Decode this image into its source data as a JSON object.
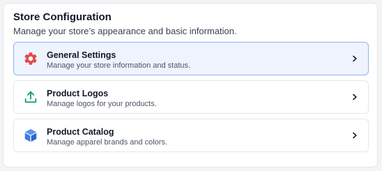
{
  "header": {
    "title": "Store Configuration",
    "subtitle": "Manage your store’s appearance and basic information."
  },
  "items": [
    {
      "label": "General Settings",
      "description": "Manage your store information and status.",
      "icon": "gear-icon",
      "icon_color": "#e5484d",
      "selected": true
    },
    {
      "label": "Product Logos",
      "description": "Manage logos for your products.",
      "icon": "upload-icon",
      "icon_color": "#1a9e6a",
      "selected": false
    },
    {
      "label": "Product Catalog",
      "description": "Manage apparel brands and colors.",
      "icon": "cube-icon",
      "icon_color": "#3b7be8",
      "selected": false
    }
  ],
  "colors": {
    "selected_background": "#eef3fd",
    "selected_border": "#93b4ee"
  }
}
